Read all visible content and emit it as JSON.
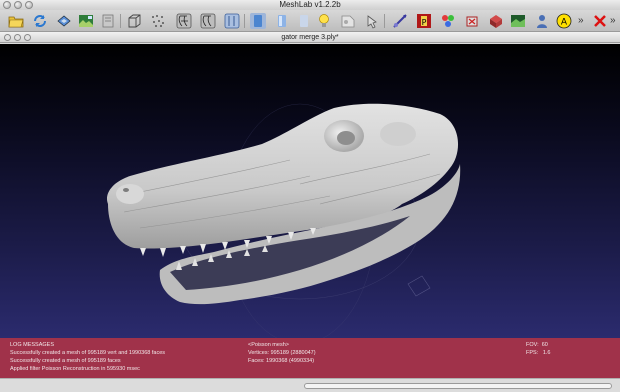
{
  "window": {
    "title": "MeshLab v1.2.2b"
  },
  "toolbar": {
    "icons": [
      "open-icon",
      "reload-icon",
      "save-icon",
      "snapshot-icon",
      "layers-icon",
      "bbox-icon",
      "points-icon",
      "wire-icon",
      "hiddenlines-icon",
      "flat-icon",
      "smooth-icon",
      "texture-icon",
      "light-icon",
      "backface-icon",
      "select-icon",
      "measure-icon",
      "paint-icon",
      "color-icon",
      "align-icon",
      "rendermode-icon",
      "person-icon",
      "annotation-icon",
      "close-red-icon"
    ],
    "overflow": "»"
  },
  "document": {
    "title": "gator merge 3.ply*"
  },
  "log": {
    "heading": "LOG MESSAGES",
    "lines": [
      "Successfully created a mesh of 995189 vert and 1990368 faces",
      "Successfully created a mesh of 995189 faces",
      "Applied filter Poisson Reconstruction in 595930 msec"
    ]
  },
  "mesh_info": {
    "name": "<Poisson mesh>",
    "vertices": "Vertices: 995189 (2880047)",
    "faces": "Faces: 1990368 (4990334)"
  },
  "view_info": {
    "fov_label": "FOV:",
    "fov_value": "60",
    "fps_label": "FPS:",
    "fps_value": "1.6"
  },
  "colors": {
    "log_bg": "#a0324a",
    "viewport_top": "#000000",
    "viewport_bottom": "#2b2b6e",
    "mesh": "#d6d6d6"
  }
}
